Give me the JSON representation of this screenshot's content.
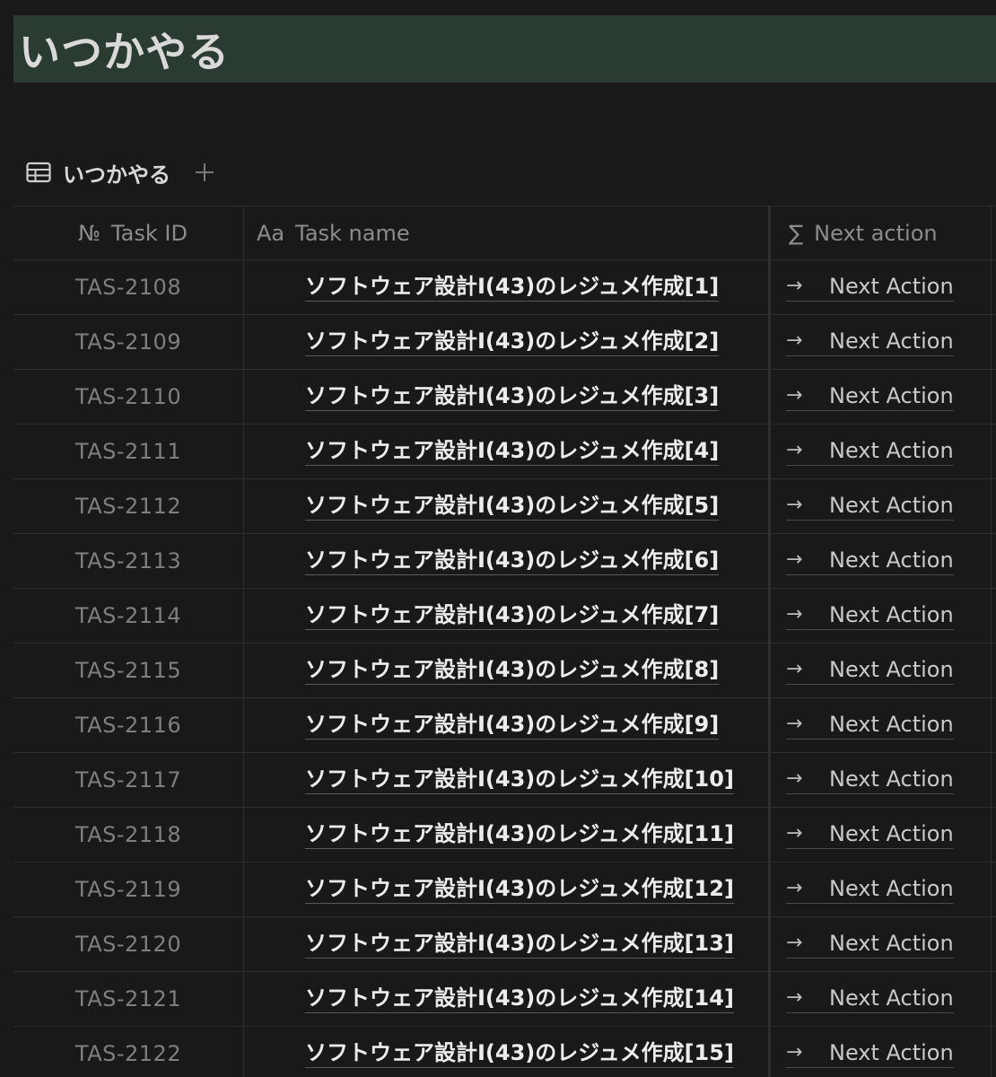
{
  "page": {
    "title": "いつかやる",
    "banner_color": "#2a3b31"
  },
  "view": {
    "tab_label": "いつかやる",
    "tab_icon": "table-icon",
    "add_icon": "plus-icon"
  },
  "table": {
    "columns": [
      {
        "icon": "№",
        "label": "Task ID",
        "icon_name": "number-icon"
      },
      {
        "icon": "Aa",
        "label": "Task name",
        "icon_name": "text-icon"
      },
      {
        "icon": "∑",
        "label": "Next action",
        "icon_name": "formula-icon"
      }
    ],
    "rows": [
      {
        "id": "TAS-2108",
        "name": "ソフトウェア設計I(43)のレジュメ作成[1]",
        "next_icon": "→",
        "next": "Next Action"
      },
      {
        "id": "TAS-2109",
        "name": "ソフトウェア設計I(43)のレジュメ作成[2]",
        "next_icon": "→",
        "next": "Next Action"
      },
      {
        "id": "TAS-2110",
        "name": "ソフトウェア設計I(43)のレジュメ作成[3]",
        "next_icon": "→",
        "next": "Next Action"
      },
      {
        "id": "TAS-2111",
        "name": "ソフトウェア設計I(43)のレジュメ作成[4]",
        "next_icon": "→",
        "next": "Next Action"
      },
      {
        "id": "TAS-2112",
        "name": "ソフトウェア設計I(43)のレジュメ作成[5]",
        "next_icon": "→",
        "next": "Next Action"
      },
      {
        "id": "TAS-2113",
        "name": "ソフトウェア設計I(43)のレジュメ作成[6]",
        "next_icon": "→",
        "next": "Next Action"
      },
      {
        "id": "TAS-2114",
        "name": "ソフトウェア設計I(43)のレジュメ作成[7]",
        "next_icon": "→",
        "next": "Next Action"
      },
      {
        "id": "TAS-2115",
        "name": "ソフトウェア設計I(43)のレジュメ作成[8]",
        "next_icon": "→",
        "next": "Next Action"
      },
      {
        "id": "TAS-2116",
        "name": "ソフトウェア設計I(43)のレジュメ作成[9]",
        "next_icon": "→",
        "next": "Next Action"
      },
      {
        "id": "TAS-2117",
        "name": "ソフトウェア設計I(43)のレジュメ作成[10]",
        "next_icon": "→",
        "next": "Next Action"
      },
      {
        "id": "TAS-2118",
        "name": "ソフトウェア設計I(43)のレジュメ作成[11]",
        "next_icon": "→",
        "next": "Next Action"
      },
      {
        "id": "TAS-2119",
        "name": "ソフトウェア設計I(43)のレジュメ作成[12]",
        "next_icon": "→",
        "next": "Next Action"
      },
      {
        "id": "TAS-2120",
        "name": "ソフトウェア設計I(43)のレジュメ作成[13]",
        "next_icon": "→",
        "next": "Next Action"
      },
      {
        "id": "TAS-2121",
        "name": "ソフトウェア設計I(43)のレジュメ作成[14]",
        "next_icon": "→",
        "next": "Next Action"
      },
      {
        "id": "TAS-2122",
        "name": "ソフトウェア設計I(43)のレジュメ作成[15]",
        "next_icon": "→",
        "next": "Next Action"
      }
    ]
  }
}
